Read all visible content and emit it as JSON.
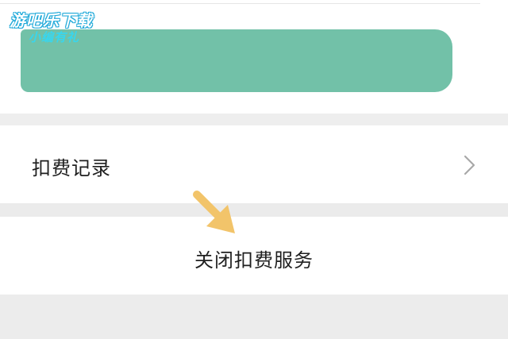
{
  "watermark": {
    "line1": "游吧乐下载",
    "line2": "小编有礼"
  },
  "records_row": {
    "label": "扣费记录",
    "chevron_icon": "chevron-right-icon"
  },
  "close_row": {
    "label": "关闭扣费服务"
  },
  "annotation": {
    "arrow_icon": "pointer-arrow-icon",
    "color": "#f2c46a"
  },
  "colors": {
    "accent_green": "#72c1a8",
    "separator_gray": "#eeeeee",
    "text": "#1f1f1f",
    "chevron": "#a8a8a8"
  }
}
